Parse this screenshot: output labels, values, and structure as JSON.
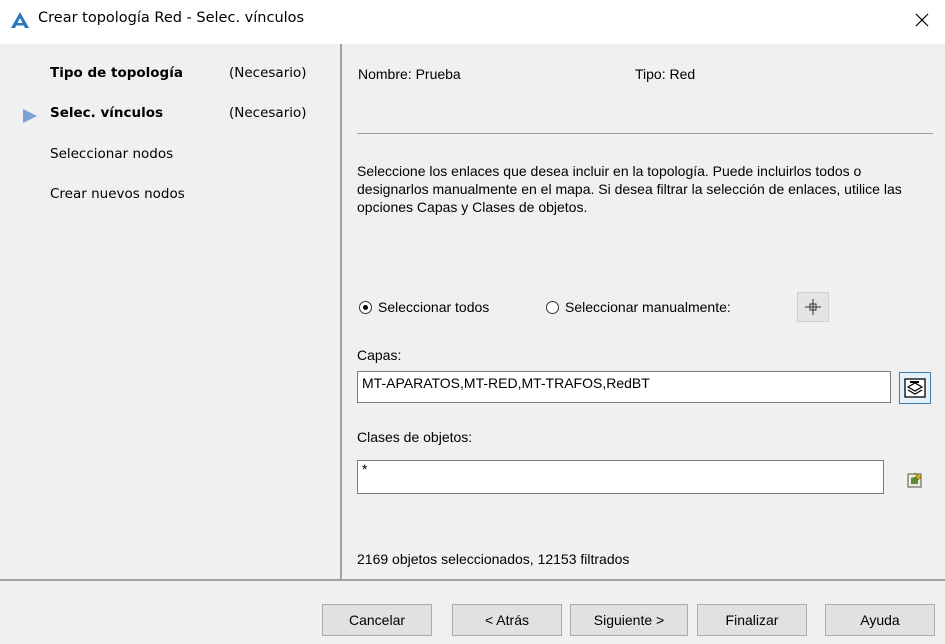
{
  "window": {
    "title": "Crear topología Red - Selec. vínculos"
  },
  "steps": [
    {
      "label": "Tipo de topología",
      "requirement": "(Necesario)"
    },
    {
      "label": "Selec. vínculos",
      "requirement": "(Necesario)"
    },
    {
      "label": "Seleccionar nodos"
    },
    {
      "label": "Crear nuevos nodos"
    }
  ],
  "info": {
    "name": "Nombre: Prueba",
    "type": "Tipo: Red"
  },
  "description": "Seleccione los enlaces que desea incluir en la topología. Puede incluirlos todos o designarlos manualmente en el mapa. Si desea filtrar la selección de enlaces, utilice las opciones Capas y Clases de objetos.",
  "selection": {
    "option_all": "Seleccionar todos",
    "option_manual": "Seleccionar manualmente:",
    "selected": "all"
  },
  "layers": {
    "label": "Capas:",
    "value": "MT-APARATOS,MT-RED,MT-TRAFOS,RedBT"
  },
  "classes": {
    "label": "Clases de objetos:",
    "value": "*"
  },
  "status": "2169 objetos seleccionados, 12153 filtrados",
  "buttons": {
    "cancel": "Cancelar",
    "back": "< Atrás",
    "next": "Siguiente >",
    "finish": "Finalizar",
    "help": "Ayuda"
  },
  "colors": {
    "accent": "#2b79c2",
    "panel_bg": "#f0f0f0",
    "arrow": "#7aa2d6"
  }
}
